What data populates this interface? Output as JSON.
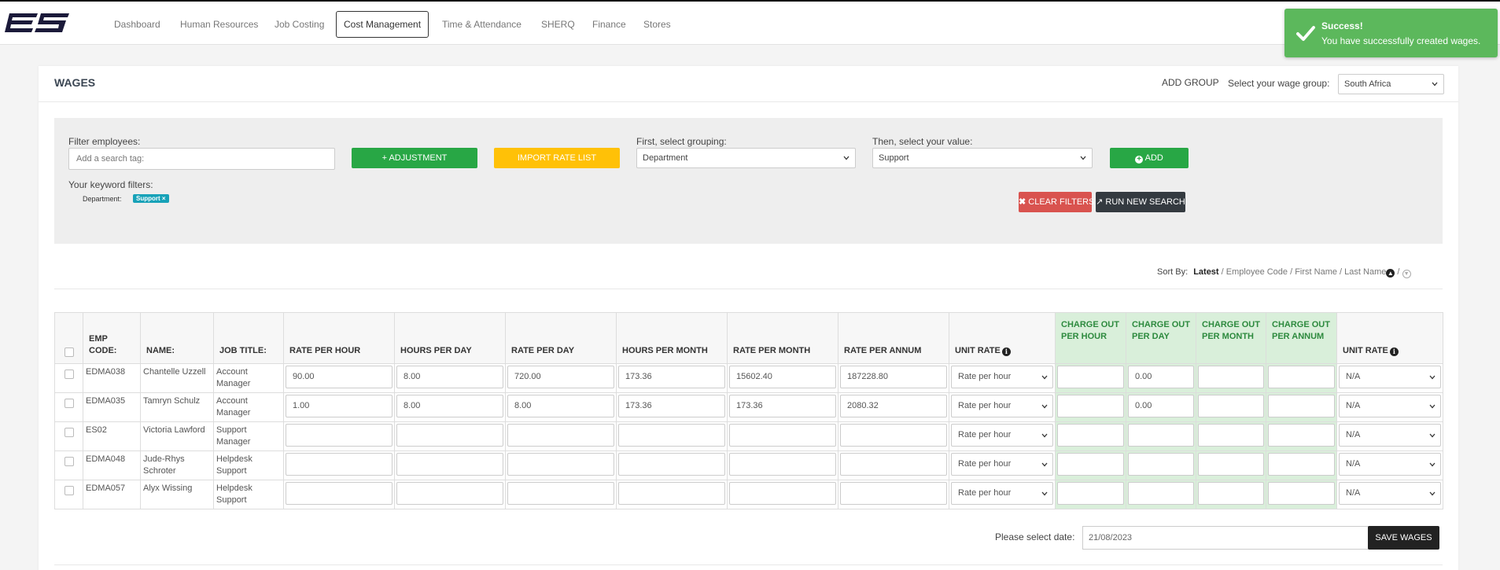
{
  "nav": {
    "logo": "ES",
    "items": [
      {
        "label": "Dashboard",
        "active": false
      },
      {
        "label": "Human Resources",
        "active": false
      },
      {
        "label": "Job Costing",
        "active": false
      },
      {
        "label": "Cost Management",
        "active": true
      },
      {
        "label": "Time & Attendance",
        "active": false
      },
      {
        "label": "SHERQ",
        "active": false
      },
      {
        "label": "Finance",
        "active": false
      },
      {
        "label": "Stores",
        "active": false
      }
    ]
  },
  "toast": {
    "title": "Success!",
    "message": "You have successfully created wages.",
    "icon": "check-icon",
    "color": "#5cb85c"
  },
  "card": {
    "title": "WAGES",
    "add_group": "ADD GROUP",
    "wage_group_label": "Select your wage group:",
    "wage_group_value": "South Africa"
  },
  "filters": {
    "filter_label": "Filter employees:",
    "search_placeholder": "Add a search tag:",
    "adjustment_button": "+ ADJUSTMENT",
    "import_button": "IMPORT RATE LIST",
    "grouping_label": "First, select grouping:",
    "grouping_value": "Department",
    "value_label": "Then, select your value:",
    "value_value": "Support",
    "add_button": "ADD",
    "keyword_label": "Your keyword filters:",
    "tag_label": "Department:",
    "tag_value": "Support ×",
    "clear_button": "CLEAR FILTERS",
    "run_button": "RUN NEW SEARCH"
  },
  "sort": {
    "label": "Sort By:",
    "active": "Latest",
    "rest": "/ Employee Code / First Name / Last Name",
    "tail": "/"
  },
  "table": {
    "headers": {
      "emp_code": "EMP CODE:",
      "name": "NAME:",
      "job_title": "JOB TITLE:",
      "rate_hour": "RATE PER HOUR",
      "hours_day": "HOURS PER DAY",
      "rate_day": "RATE PER DAY",
      "hours_month": "HOURS PER MONTH",
      "rate_month": "RATE PER MONTH",
      "rate_annum": "RATE PER ANNUM",
      "unit_rate": "UNIT RATE",
      "charge_hour": "CHARGE OUT PER HOUR",
      "charge_day": "CHARGE OUT PER DAY",
      "charge_month": "CHARGE OUT PER MONTH",
      "charge_annum": "CHARGE OUT PER ANNUM",
      "unit_rate_2": "UNIT RATE"
    },
    "rows": [
      {
        "code": "EDMA038",
        "name": "Chantelle Uzzell",
        "job": "Account Manager",
        "rate_hour": "90.00",
        "hours_day": "8.00",
        "rate_day": "720.00",
        "hours_month": "173.36",
        "rate_month": "15602.40",
        "rate_annum": "187228.80",
        "unit_rate": "Rate per hour",
        "charge_hour": "",
        "charge_day": "0.00",
        "charge_month": "",
        "charge_annum": "",
        "unit_rate_2": "N/A"
      },
      {
        "code": "EDMA035",
        "name": "Tamryn Schulz",
        "job": "Account Manager",
        "rate_hour": "1.00",
        "hours_day": "8.00",
        "rate_day": "8.00",
        "hours_month": "173.36",
        "rate_month": "173.36",
        "rate_annum": "2080.32",
        "unit_rate": "Rate per hour",
        "charge_hour": "",
        "charge_day": "0.00",
        "charge_month": "",
        "charge_annum": "",
        "unit_rate_2": "N/A"
      },
      {
        "code": "ES02",
        "name": "Victoria Lawford",
        "job": "Support Manager",
        "rate_hour": "",
        "hours_day": "",
        "rate_day": "",
        "hours_month": "",
        "rate_month": "",
        "rate_annum": "",
        "unit_rate": "Rate per hour",
        "charge_hour": "",
        "charge_day": "",
        "charge_month": "",
        "charge_annum": "",
        "unit_rate_2": "N/A"
      },
      {
        "code": "EDMA048",
        "name": "Jude-Rhys Schroter",
        "job": "Helpdesk Support",
        "rate_hour": "",
        "hours_day": "",
        "rate_day": "",
        "hours_month": "",
        "rate_month": "",
        "rate_annum": "",
        "unit_rate": "Rate per hour",
        "charge_hour": "",
        "charge_day": "",
        "charge_month": "",
        "charge_annum": "",
        "unit_rate_2": "N/A"
      },
      {
        "code": "EDMA057",
        "name": "Alyx Wissing",
        "job": "Helpdesk Support",
        "rate_hour": "",
        "hours_day": "",
        "rate_day": "",
        "hours_month": "",
        "rate_month": "",
        "rate_annum": "",
        "unit_rate": "Rate per hour",
        "charge_hour": "",
        "charge_day": "",
        "charge_month": "",
        "charge_annum": "",
        "unit_rate_2": "N/A"
      }
    ]
  },
  "footer": {
    "date_label": "Please select date:",
    "date_value": "21/08/2023",
    "save_button": "SAVE WAGES"
  },
  "colors": {
    "success": "#5cb85c",
    "green_button": "#28a745",
    "yellow_button": "#ffc107",
    "red_button": "#d9534f",
    "dark_button": "#343a40",
    "charge_column_bg": "#d9efda"
  }
}
